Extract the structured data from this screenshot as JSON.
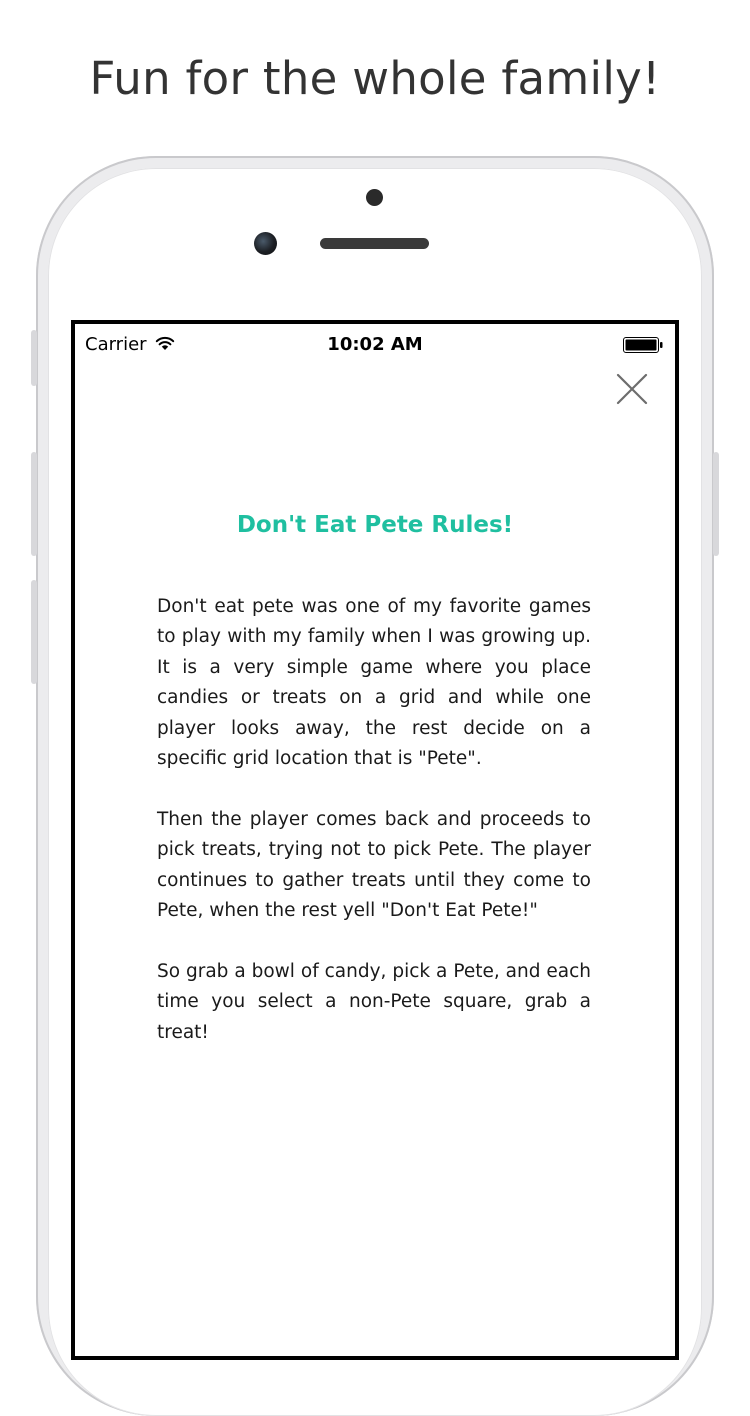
{
  "headline": "Fun for the whole family!",
  "status_bar": {
    "carrier": "Carrier",
    "time": "10:02 AM"
  },
  "modal": {
    "title": "Don't Eat Pete Rules!",
    "paragraphs": [
      "Don't eat pete was one of my favorite games to play with my family when I was growing up. It is a very simple game where you place candies or treats on a grid and while one player looks away, the rest decide on a specific grid location that is \"Pete\".",
      "Then the player comes back and proceeds to pick treats, trying not to pick Pete. The player continues to gather treats until they come to Pete, when the rest yell \"Don't Eat Pete!\"",
      "So grab a bowl of candy, pick a Pete, and each time you select a non-Pete square, grab a treat!"
    ]
  },
  "icons": {
    "close": "close-icon",
    "wifi": "wifi-icon",
    "battery": "battery-icon"
  },
  "colors": {
    "accent": "#1fbfa0",
    "headline": "#333333"
  }
}
